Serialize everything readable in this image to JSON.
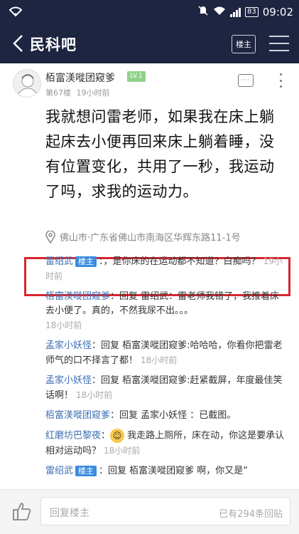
{
  "status_bar": {
    "time": "09:02",
    "battery": "83"
  },
  "nav": {
    "title": "民科吧",
    "owner_button": "楼主"
  },
  "post": {
    "author": "栢富渼嘥团窥爹",
    "level": "LV.1",
    "floor": "第67楼",
    "time": "19小时前",
    "body": "我就想问雷老师，如果我在床上躺起床去小便再回来床上躺着睡，没有位置变化，共用了一秒，我运动了吗，求我的运动力。",
    "location": "佛山市·广东省佛山市南海区华辉东路11-1号"
  },
  "comments": [
    {
      "name": "雷绍武",
      "owner_tag": "楼主",
      "text": "：，是你床的在运动都不知道？白痴吗？",
      "time": "19小时前"
    },
    {
      "name": "栢富渼嘥团窥爹",
      "text": "：回复 雷绍武：雷老师我错了，我推着床去小便了。真的，不然我尿不出。。。",
      "time": "18小时前"
    },
    {
      "name": "孟家小妖怪",
      "text": "：回复 栢富渼嘥团窥爹:哈哈哈，你看你把雷老师气的口不择言了都！",
      "time": "18小时前"
    },
    {
      "name": "孟家小妖怪",
      "text": "：回复 栢富渼嘥团窥爹:赶紧截屏，年度最佳笑话啊！",
      "time": "18小时前"
    },
    {
      "name": "栢富渼嘥团窥爹",
      "text": "：回复 孟家小妖怪 ：已截图。",
      "time": ""
    },
    {
      "name": "红磨坊巴黎夜",
      "text": "我走路上厕所，床在动，你这是要承认相对运动吗？",
      "time": "18小时前",
      "emoji": true
    },
    {
      "name": "雷绍武",
      "owner_tag": "楼主",
      "text": "：回复 栢富渼嘥团窥爹 啊，你又是“",
      "time": ""
    }
  ],
  "bottom": {
    "reply_placeholder": "回复楼主",
    "reply_count": "已有294条回贴"
  },
  "colors": {
    "nav_bg": "#1d2541",
    "link": "#3b6db3",
    "owner_tag": "#3b8be0",
    "highlight": "#d8262f",
    "level_badge": "#8fd18a"
  }
}
